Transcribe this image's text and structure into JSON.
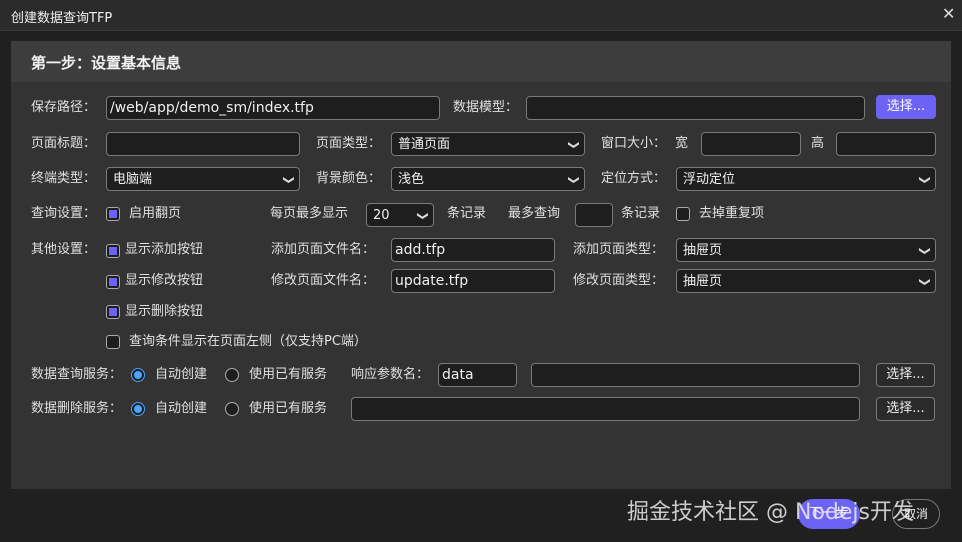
{
  "window": {
    "title": "创建数据查询TFP",
    "close_icon": "close-icon"
  },
  "step_title": "第一步：设置基本信息",
  "row1": {
    "save_path_label": "保存路径：",
    "save_path_value": "/web/app/demo_sm/index.tfp",
    "data_model_label": "数据模型：",
    "data_model_value": "",
    "select_button": "选择..."
  },
  "row2": {
    "page_title_label": "页面标题：",
    "page_title_value": "",
    "page_type_label": "页面类型：",
    "page_type_value": "普通页面",
    "window_size_label": "窗口大小：",
    "width_label": "宽",
    "height_label": "高"
  },
  "row3": {
    "terminal_label": "终端类型：",
    "terminal_value": "电脑端",
    "bg_label": "背景颜色：",
    "bg_value": "浅色",
    "position_label": "定位方式：",
    "position_value": "浮动定位"
  },
  "row4": {
    "query_label": "查询设置：",
    "paging_label": "启用翻页",
    "paging_checked": true,
    "per_page_label": "每页最多显示",
    "per_page_value": "20",
    "records_label": "条记录",
    "max_query_label": "最多查询",
    "max_query_value": "",
    "records_label2": "条记录",
    "dedupe_label": "去掉重复项",
    "dedupe_checked": false
  },
  "other": {
    "label": "其他设置：",
    "show_add": "显示添加按钮",
    "show_edit": "显示修改按钮",
    "show_delete": "显示删除按钮",
    "left_query": "查询条件显示在页面左侧（仅支持PC端）",
    "add_file_label": "添加页面文件名：",
    "add_file_value": "add.tfp",
    "add_type_label": "添加页面类型：",
    "add_type_value": "抽屉页",
    "edit_file_label": "修改页面文件名：",
    "edit_file_value": "update.tfp",
    "edit_type_label": "修改页面类型：",
    "edit_type_value": "抽屉页"
  },
  "query_service": {
    "label": "数据查询服务：",
    "auto": "自动创建",
    "existing": "使用已有服务",
    "selected": "auto",
    "resp_label": "响应参数名：",
    "resp_value": "data",
    "service_value": "",
    "select_button": "选择..."
  },
  "delete_service": {
    "label": "数据删除服务：",
    "auto": "自动创建",
    "existing": "使用已有服务",
    "selected": "auto",
    "service_value": "",
    "select_button": "选择..."
  },
  "footer": {
    "next": "下一步",
    "cancel": "取消"
  },
  "watermark": "掘金技术社区 @ Nodejs开发",
  "colors": {
    "accent": "#6c63f5",
    "radio": "#4aa3ff"
  }
}
